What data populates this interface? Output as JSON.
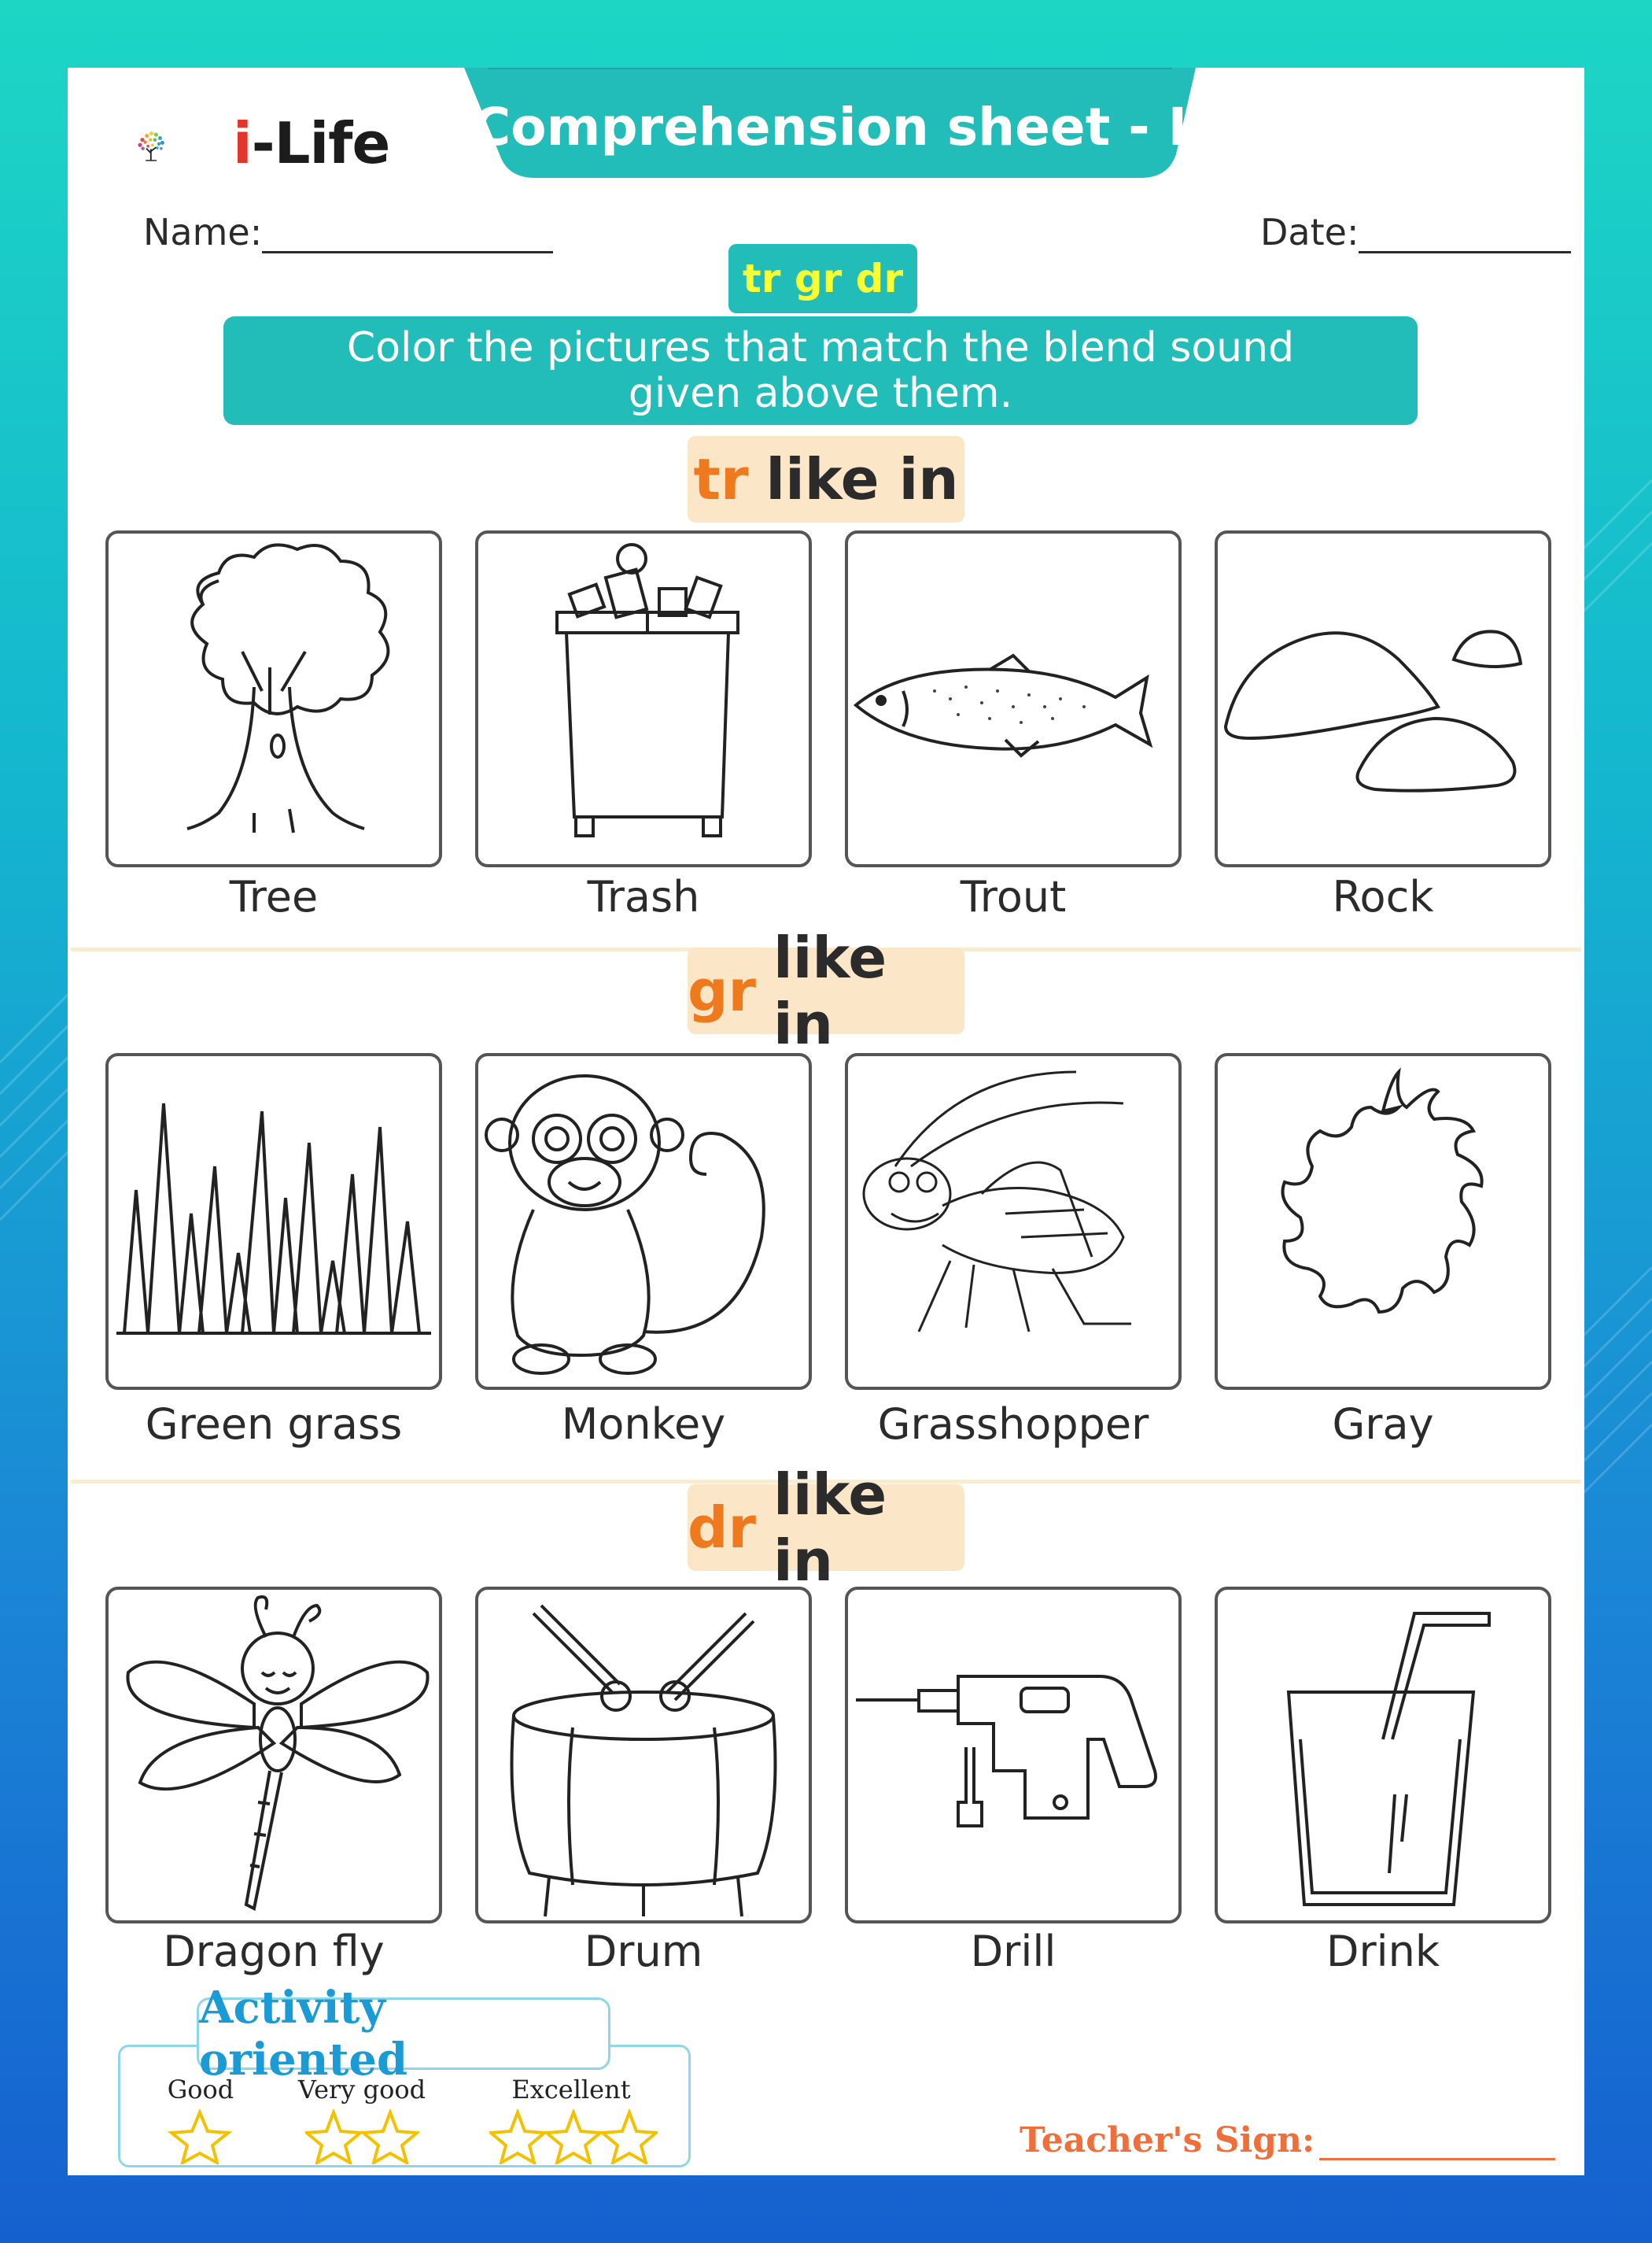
{
  "brand": {
    "logo_text": "i-Life"
  },
  "title": "Comprehension sheet - I",
  "fields": {
    "name_label": "Name:",
    "date_label": "Date:"
  },
  "blend_badge": "tr gr dr",
  "instruction": "Color the pictures that match the blend sound given above them.",
  "sections": [
    {
      "blend": "tr",
      "suffix": "like in",
      "items": [
        "Tree",
        "Trash",
        "Trout",
        "Rock"
      ],
      "icons": [
        "tree-icon",
        "trash-bin-icon",
        "trout-fish-icon",
        "rock-icon"
      ]
    },
    {
      "blend": "gr",
      "suffix": "like in",
      "items": [
        "Green grass",
        "Monkey",
        "Grasshopper",
        "Gray"
      ],
      "icons": [
        "grass-icon",
        "monkey-icon",
        "grasshopper-icon",
        "gray-splash-icon"
      ]
    },
    {
      "blend": "dr",
      "suffix": "like in",
      "items": [
        "Dragon fly",
        "Drum",
        "Drill",
        "Drink"
      ],
      "icons": [
        "dragonfly-icon",
        "drum-icon",
        "drill-icon",
        "drink-glass-icon"
      ]
    }
  ],
  "activity": {
    "title": "Activity oriented",
    "ratings": [
      {
        "label": "Good",
        "stars": 1
      },
      {
        "label": "Very good",
        "stars": 2
      },
      {
        "label": "Excellent",
        "stars": 3
      }
    ]
  },
  "teacher_sign_label": "Teacher's Sign:",
  "colors": {
    "teal": "#22bdb8",
    "orange": "#ef7a1d",
    "badge_text": "#f8ff33",
    "section_bg": "#fbe7c7",
    "activity_blue": "#1a9bd5",
    "sign_orange": "#ef6f3a"
  }
}
